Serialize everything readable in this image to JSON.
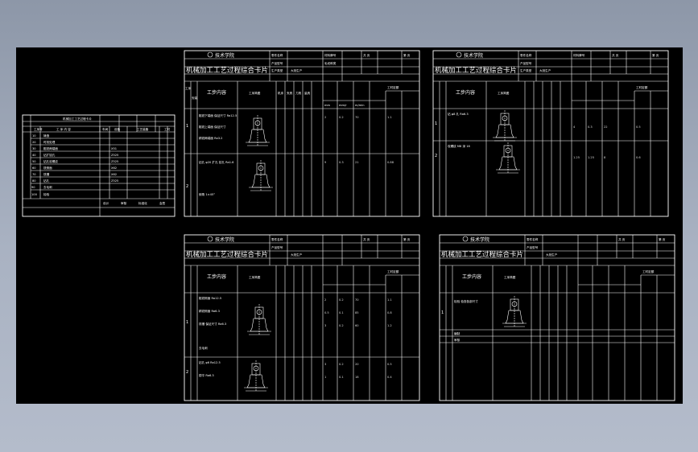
{
  "colors": {
    "background": "#000000",
    "lines": "#ffffff",
    "desktop": "#a3acbc"
  },
  "card": {
    "logo_text": "技术学院",
    "title": "机械加工工艺过程综合卡片",
    "header_labels": [
      "零件名称",
      "产品型号",
      "生产类型",
      "大批生产",
      "材料牌号",
      "毛坯种类",
      "毛坯尺寸",
      "每台件数",
      "备注",
      "共 页",
      "第 页"
    ],
    "col_labels": [
      "工序",
      "安装",
      "工步",
      "工步内容",
      "工序简图",
      "机床",
      "夹具",
      "刀具",
      "量具",
      "走刀次数",
      "切削深度",
      "进给量",
      "切削速度",
      "工时定额"
    ],
    "units": [
      "mm",
      "mm/r",
      "m/min",
      "min"
    ]
  },
  "card1": {
    "steps": [
      {
        "no": "1",
        "text": "粗铣下端面 保证尺寸 Ra12.5",
        "vals": [
          "1",
          "2",
          "0.2",
          "70",
          "1.1"
        ]
      },
      {
        "no": "2",
        "text": "粗铣上端面 保证尺寸",
        "vals": [
          "1",
          "2",
          "0.2",
          "70",
          "1.1"
        ]
      },
      {
        "no": "3",
        "text": "精铣两端面 Ra3.2",
        "vals": [
          "1",
          "0.5",
          "0.1",
          "85",
          "0.8"
        ]
      },
      {
        "no": "4",
        "text": "钻孔 φ20 扩孔 铰孔 Ra1.6",
        "vals": [
          "1",
          "9",
          "0.3",
          "21",
          "0.88"
        ]
      },
      {
        "no": "5",
        "text": "倒角 1×45°",
        "vals": [
          "1",
          "1",
          "0.2",
          "18",
          "0.5"
        ]
      }
    ]
  },
  "card2": {
    "steps": [
      {
        "no": "1",
        "text": "钻 φ8 孔 Ra6.3",
        "vals": [
          "1",
          "4",
          "0.3",
          "22",
          "0.5"
        ]
      },
      {
        "no": "2",
        "text": "攻螺纹 M8 深 16",
        "vals": [
          "1",
          "1.25",
          "1.25",
          "8",
          "0.6"
        ]
      }
    ]
  },
  "card3": {
    "steps": [
      {
        "no": "1",
        "text": "粗铣侧面 Ra12.5",
        "vals": [
          "1",
          "2",
          "0.2",
          "70",
          "1.1"
        ]
      },
      {
        "no": "2",
        "text": "精铣侧面 Ra6.3",
        "vals": [
          "1",
          "0.5",
          "0.1",
          "85",
          "0.8"
        ]
      },
      {
        "no": "3",
        "text": "铣槽 保证尺寸 Ra6.3",
        "vals": [
          "1",
          "3",
          "0.2",
          "60",
          "1.2"
        ]
      },
      {
        "no": "4",
        "text": "去毛刺",
        "vals": [
          "1",
          "",
          "",
          "",
          ""
        ]
      },
      {
        "no": "5",
        "text": "钻孔 φ6 Ra12.5",
        "vals": [
          "1",
          "3",
          "0.2",
          "20",
          "0.5"
        ]
      },
      {
        "no": "6",
        "text": "锪平 Ra6.3",
        "vals": [
          "1",
          "1",
          "0.1",
          "18",
          "0.4"
        ]
      }
    ]
  },
  "card4": {
    "steps": [
      {
        "no": "1",
        "text": "检验 检查各部尺寸",
        "vals": [
          "1",
          "",
          "",
          "",
          ""
        ]
      }
    ],
    "footer": [
      "编制",
      "审核"
    ]
  },
  "summary": {
    "title": "机械加工工艺过程卡片",
    "headers": [
      "工序号",
      "工 序 内 容",
      "车间",
      "设备",
      "工艺装备",
      "工时"
    ],
    "rows": [
      [
        "10",
        "铸造",
        ""
      ],
      [
        "20",
        "时效处理",
        ""
      ],
      [
        "30",
        "粗铣两端面",
        "X51"
      ],
      [
        "40",
        "钻扩铰孔",
        "Z525"
      ],
      [
        "50",
        "钻孔攻螺纹",
        "Z525"
      ],
      [
        "60",
        "铣侧面",
        "X62"
      ],
      [
        "70",
        "铣槽",
        "X62"
      ],
      [
        "80",
        "钻孔",
        "Z525"
      ],
      [
        "90",
        "去毛刺",
        ""
      ],
      [
        "100",
        "检验",
        ""
      ]
    ],
    "footer": [
      "设计",
      "审核",
      "标准化",
      "会签"
    ]
  }
}
